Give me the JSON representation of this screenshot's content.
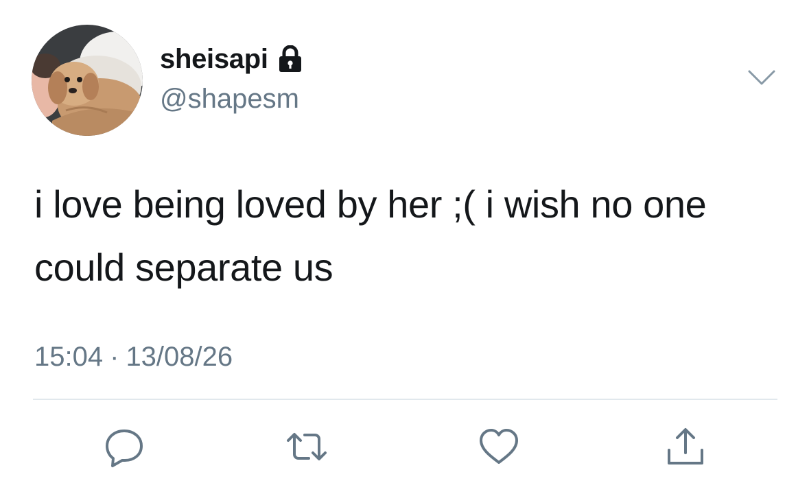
{
  "tweet": {
    "author": {
      "display_name": "sheisapi",
      "handle": "@shapesm",
      "protected_icon": "lock-icon",
      "avatar": "profile photo of a fluffy dog"
    },
    "menu_icon": "chevron-down-icon",
    "text": "i love being loved by her ;( i wish no one could separate us",
    "time": "15:04",
    "separator": "·",
    "date": "13/08/26"
  },
  "actions": [
    {
      "icon": "reply-icon"
    },
    {
      "icon": "retweet-icon"
    },
    {
      "icon": "like-icon"
    },
    {
      "icon": "share-icon"
    }
  ],
  "colors": {
    "text": "#14171a",
    "secondary": "#657786",
    "divider": "#e1e8ed",
    "icon": "#657786"
  }
}
